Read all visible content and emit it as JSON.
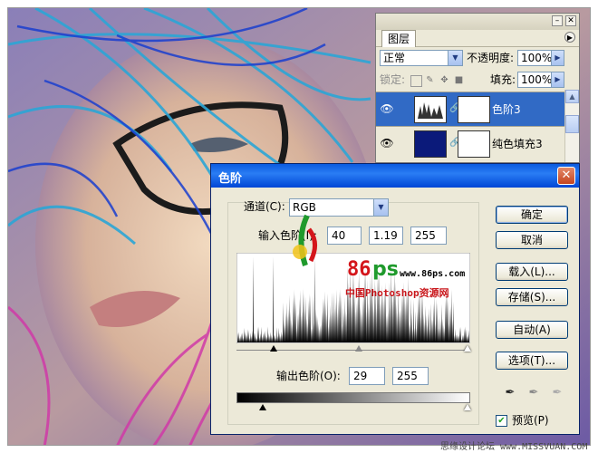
{
  "layers_panel": {
    "tab_label": "图层",
    "blend_mode": "正常",
    "opacity_label": "不透明度:",
    "opacity_value": "100%",
    "lock_label": "锁定:",
    "fill_label": "填充:",
    "fill_value": "100%",
    "layers": [
      {
        "name": "色阶3",
        "selected": true
      },
      {
        "name": "纯色填充3",
        "selected": false
      }
    ]
  },
  "levels_dialog": {
    "title": "色阶",
    "channel_label": "通道(C):",
    "channel_value": "RGB",
    "input_levels_label": "输入色阶(I):",
    "input_black": "40",
    "input_gamma": "1.19",
    "input_white": "255",
    "output_levels_label": "输出色阶(O):",
    "output_black": "29",
    "output_white": "255",
    "buttons": {
      "ok": "确定",
      "cancel": "取消",
      "load": "载入(L)...",
      "save": "存储(S)...",
      "auto": "自动(A)",
      "options": "选项(T)..."
    },
    "preview_label": "预览(P)",
    "preview_checked": true
  },
  "watermarks": {
    "site_logo_number": "86",
    "site_url": "www.86ps.com",
    "site_name": "中国Photoshop资源网",
    "footer": "思缘设计论坛 www.MISSVUAN.COM"
  }
}
